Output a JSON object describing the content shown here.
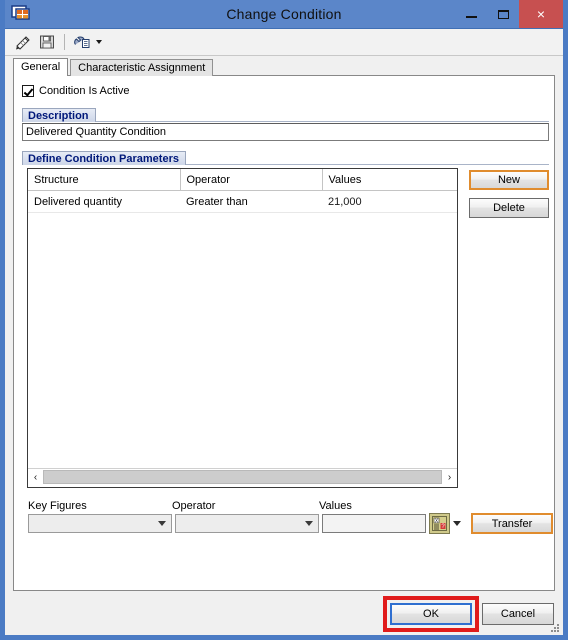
{
  "window": {
    "title": "Change Condition",
    "icon": "structure-icon",
    "caption_buttons": {
      "minimize": "minimize-icon",
      "maximize": "maximize-icon",
      "close": "close-icon",
      "close_glyph": "×"
    }
  },
  "toolbar": {
    "items": [
      {
        "name": "check-edit-icon",
        "label": ""
      },
      {
        "name": "save-icon",
        "label": ""
      },
      {
        "name": "tools-dropdown-icon",
        "label": ""
      }
    ]
  },
  "tabs": [
    {
      "label": "General",
      "active": true
    },
    {
      "label": "Characteristic Assignment",
      "active": false
    }
  ],
  "general_tab": {
    "active_checkbox": {
      "label": "Condition Is Active",
      "checked": true
    },
    "description_group": {
      "title": "Description",
      "value": "Delivered Quantity Condition",
      "placeholder": ""
    },
    "parameters_group": {
      "title": "Define Condition Parameters",
      "table": {
        "columns": [
          "Structure",
          "Operator",
          "Values"
        ],
        "rows": [
          [
            "Delivered quantity",
            "Greater than",
            "21,000"
          ]
        ]
      },
      "scrollbar": {
        "left_arrow": "‹",
        "right_arrow": "›"
      },
      "side_buttons": [
        {
          "label": "New",
          "focused": true
        },
        {
          "label": "Delete",
          "focused": false
        }
      ]
    },
    "entry_row": {
      "key_figures": {
        "label": "Key Figures",
        "value": "",
        "placeholder": ""
      },
      "operator": {
        "label": "Operator",
        "value": "",
        "placeholder": ""
      },
      "values": {
        "label": "Values",
        "value": "",
        "placeholder": ""
      },
      "value_help_icon": "value-help-icon",
      "transfer_button": {
        "label": "Transfer",
        "focused": true
      }
    }
  },
  "footer": {
    "ok_button": {
      "label": "OK",
      "default": true,
      "highlighted": true
    },
    "cancel_button": {
      "label": "Cancel",
      "default": false
    }
  },
  "colors": {
    "title_bar": "#5b86c9",
    "window_frame": "#4b7bc4",
    "close_button": "#c75050",
    "group_title_text": "#00187a",
    "focus_border": "#e08c2e",
    "default_button_border": "#2f6fd0",
    "annotation_box": "#e01b1b"
  }
}
